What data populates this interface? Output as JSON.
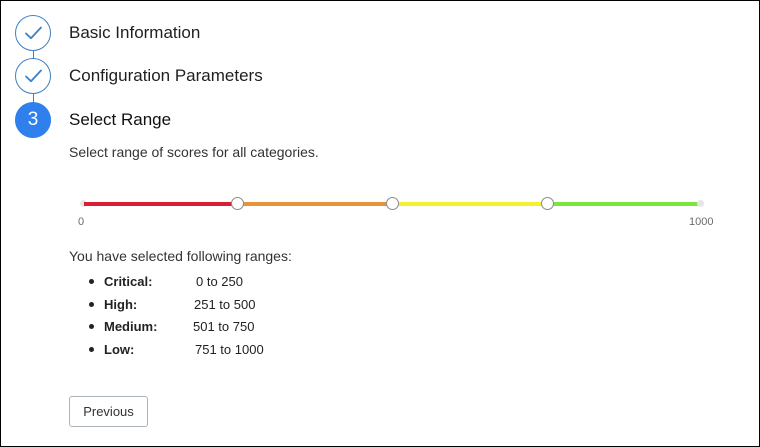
{
  "steps": [
    {
      "label": "Basic Information",
      "state": "completed",
      "icon": "check-icon"
    },
    {
      "label": "Configuration Parameters",
      "state": "completed",
      "icon": "check-icon"
    },
    {
      "label": "Select Range",
      "state": "active",
      "number": "3"
    }
  ],
  "range_section": {
    "instructions": "Select range of scores for all categories.",
    "slider": {
      "min_label": "0",
      "max_label": "1000",
      "min": 0,
      "max": 1000,
      "handle_values": [
        250,
        500,
        750
      ],
      "segment_colors": [
        "#d71f36",
        "#e4943a",
        "#f4f12e",
        "#79e53d"
      ]
    },
    "summary_title": "You have selected following ranges:",
    "ranges": [
      {
        "label": "Critical:",
        "value": "0 to 250"
      },
      {
        "label": "High:",
        "value": "251 to 500"
      },
      {
        "label": "Medium:",
        "value": "501 to 750"
      },
      {
        "label": "Low:",
        "value": "751 to 1000"
      }
    ]
  },
  "actions": {
    "previous_label": "Previous"
  },
  "colors": {
    "step_accent": "#2f80ed",
    "step_outline": "#3b82c4"
  }
}
